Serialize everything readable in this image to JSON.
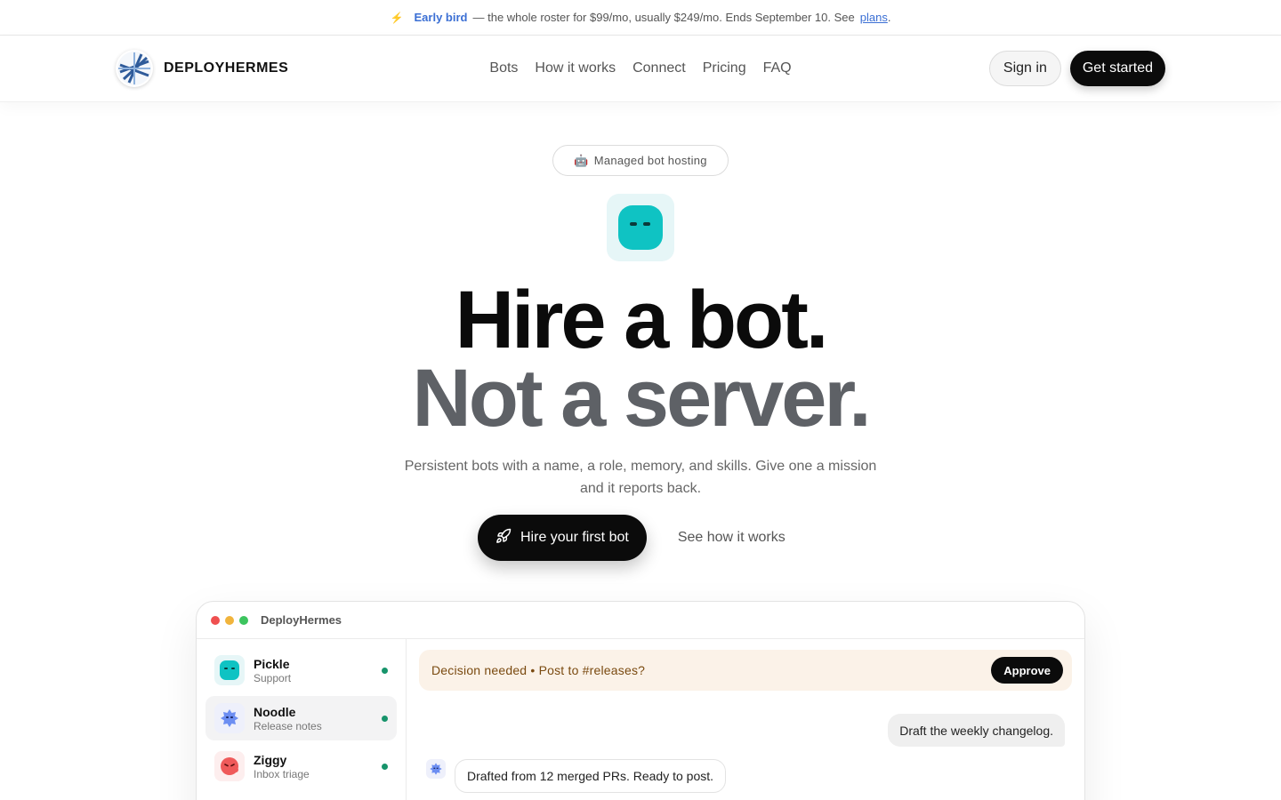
{
  "announcement": {
    "early_bird": "Early bird",
    "text": "— the whole roster for $99/mo, usually $249/mo. Ends September 10. See",
    "link": "plans",
    "period": "."
  },
  "nav": {
    "brand": "DEPLOYHERMES",
    "links": [
      "Bots",
      "How it works",
      "Connect",
      "Pricing",
      "FAQ"
    ],
    "sign_in": "Sign in",
    "get_started": "Get started"
  },
  "hero": {
    "pill_emoji": "🤖",
    "pill": "Managed bot hosting",
    "title_line1": "Hire a bot.",
    "title_line2": "Not a server.",
    "subtitle": "Persistent bots with a name, a role, memory, and skills. Give one a mission and it reports back.",
    "primary_cta": "Hire your first bot",
    "secondary_cta": "See how it works"
  },
  "app": {
    "window_title": "DeployHermes",
    "bots": [
      {
        "name": "Pickle",
        "role": "Support",
        "color": "#10c4c4"
      },
      {
        "name": "Noodle",
        "role": "Release notes",
        "color": "#6c8ef2"
      },
      {
        "name": "Ziggy",
        "role": "Inbox triage",
        "color": "#ef5a5a"
      }
    ],
    "decision": "Decision needed • Post to #releases?",
    "approve": "Approve",
    "user_message": "Draft the weekly changelog.",
    "bot_message": "Drafted from 12 merged PRs. Ready to post."
  },
  "colors": {
    "accent_blue": "#3b6fd4",
    "status_green": "#17946b",
    "dark": "#0b0b0b",
    "decision_bg": "#fbf2e8"
  }
}
